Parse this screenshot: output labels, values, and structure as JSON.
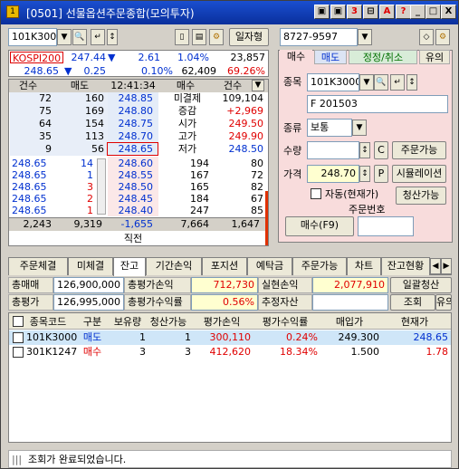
{
  "window": {
    "title": "[0501] 선물옵션주문종합(모의투자)",
    "icon": "1",
    "buttons": [
      "▣",
      "▣",
      "3",
      "⊟",
      "A",
      "?",
      "_",
      "□",
      "X"
    ]
  },
  "left": {
    "code": "101K3000",
    "date_btn": "일자형",
    "kospi_label": "KOSPI200",
    "kospi_value": "247.44",
    "kospi_arrow": "▼",
    "kospi_change": "2.61",
    "kospi_rate": "1.04%",
    "kospi_vol": "23,857",
    "fut_price": "248.65",
    "fut_arrow": "▼",
    "fut_change": "0.25",
    "fut_rate": "0.10%",
    "fut_vol": "62,409",
    "fut_ratio": "69.26%",
    "hdr": [
      "건수",
      "매도",
      "12:41:34",
      "매수",
      "건수"
    ],
    "ask_rows": [
      [
        "72",
        "160",
        "248.85",
        "미결제",
        "109,104"
      ],
      [
        "75",
        "169",
        "248.80",
        "증감",
        "+2,969"
      ],
      [
        "64",
        "154",
        "248.75",
        "시가",
        "249.50"
      ],
      [
        "35",
        "113",
        "248.70",
        "고가",
        "249.90"
      ],
      [
        "9",
        "56",
        "248.65",
        "저가",
        "248.50"
      ]
    ],
    "bid_rows": [
      [
        "248.65",
        "14",
        "248.60",
        "194",
        "80"
      ],
      [
        "248.65",
        "1",
        "248.55",
        "167",
        "72"
      ],
      [
        "248.65",
        "3",
        "248.50",
        "165",
        "82"
      ],
      [
        "248.65",
        "2",
        "248.45",
        "184",
        "67"
      ],
      [
        "248.65",
        "1",
        "248.40",
        "247",
        "85"
      ]
    ],
    "totals": [
      "2,243",
      "9,319",
      "-1,655",
      "7,664",
      "1,647"
    ],
    "bottom": "직전"
  },
  "right": {
    "account": "8727-9597",
    "tabs": [
      "매수",
      "매도",
      "정정/취소",
      "유의"
    ],
    "code_label": "종목",
    "code": "101K3000",
    "name": "F 201503",
    "type_label": "종류",
    "type_val": "보통",
    "qty_label": "수량",
    "c_btn": "C",
    "avail_btn": "주문가능",
    "price_label": "가격",
    "price": "248.70",
    "p_btn": "P",
    "sim_btn": "시뮬레이션",
    "auto_label": "자동(현재가)",
    "clear_btn": "청산가능",
    "order_no_label": "주문번호",
    "buy_btn": "매수(F9)"
  },
  "tabs": [
    "주문체결",
    "미체결",
    "잔고",
    "기간손익",
    "포지션",
    "예탁금",
    "주문가능",
    "차트",
    "잔고현황"
  ],
  "summary": {
    "buy_total_label": "총매매",
    "buy_total": "126,900,000",
    "eval_pl_label": "총평가손익",
    "eval_pl": "712,730",
    "real_pl_label": "실현손익",
    "real_pl": "2,077,910",
    "clear_all_btn": "일괄청산",
    "eval_total_label": "총평가",
    "eval_total": "126,995,000",
    "eval_rate_label": "총평가수익률",
    "eval_rate": "0.56%",
    "est_label": "추정자산",
    "query_btn": "조회",
    "note_btn": "유의"
  },
  "table": {
    "headers": [
      "종목코드",
      "구분",
      "보유량",
      "청산가능",
      "평가손익",
      "평가수익률",
      "매입가",
      "현재가"
    ],
    "rows": [
      [
        "101K3000",
        "매도",
        "1",
        "1",
        "300,110",
        "0.24%",
        "249.300",
        "248.65"
      ],
      [
        "301K1247",
        "매수",
        "3",
        "3",
        "412,620",
        "18.34%",
        "1.500",
        "1.78"
      ]
    ]
  },
  "status": "조회가 완료되었습니다."
}
